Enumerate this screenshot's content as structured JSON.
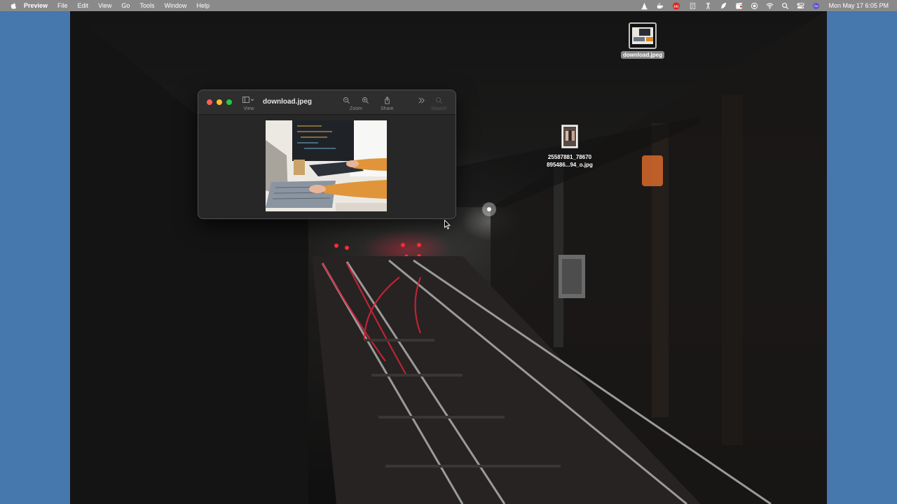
{
  "menubar": {
    "app_name": "Preview",
    "items": [
      "File",
      "Edit",
      "View",
      "Go",
      "Tools",
      "Window",
      "Help"
    ],
    "status_icons": [
      "vlc-icon",
      "cup-icon",
      "notification-badge-icon",
      "doc-icon",
      "radio-tower-icon",
      "feather-icon",
      "clapper-icon",
      "record-icon",
      "wifi-icon",
      "search-icon",
      "control-center-icon",
      "siri-icon"
    ],
    "badge_count": "181",
    "clock": "Mon May 17  6:05 PM"
  },
  "window": {
    "title": "download.jpeg",
    "toolbar": {
      "view_label": "View",
      "zoom_label": "Zoom",
      "share_label": "Share",
      "search_label": "Search"
    }
  },
  "desktop": {
    "icons": [
      {
        "label": "download.jpeg"
      },
      {
        "label_line1": "25587881_78670",
        "label_line2": "895486...94_o.jpg"
      }
    ]
  },
  "colors": {
    "accent": "#4677ad",
    "close": "#ff5f57",
    "minimize": "#febc2e",
    "zoom": "#28c840"
  }
}
